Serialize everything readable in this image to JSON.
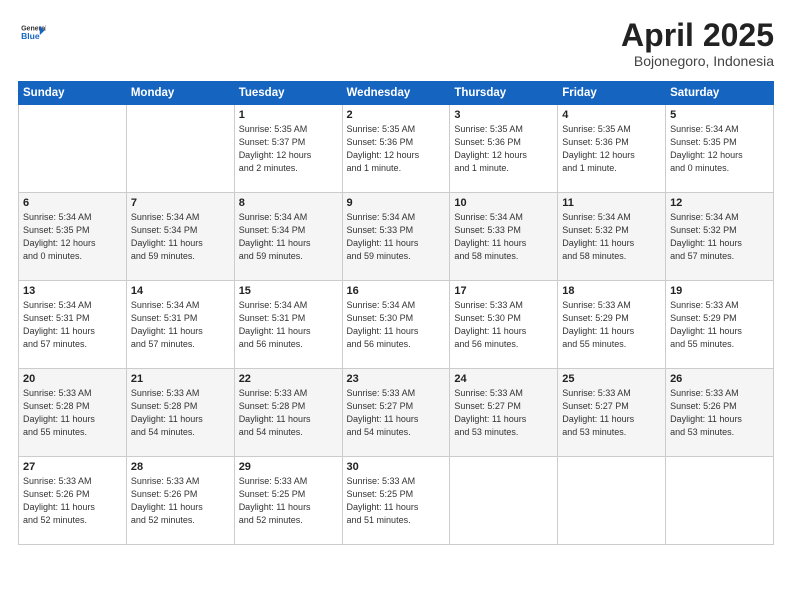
{
  "header": {
    "logo_line1": "General",
    "logo_line2": "Blue",
    "month": "April 2025",
    "location": "Bojonegoro, Indonesia"
  },
  "days_of_week": [
    "Sunday",
    "Monday",
    "Tuesday",
    "Wednesday",
    "Thursday",
    "Friday",
    "Saturday"
  ],
  "weeks": [
    [
      {
        "day": "",
        "detail": ""
      },
      {
        "day": "",
        "detail": ""
      },
      {
        "day": "1",
        "detail": "Sunrise: 5:35 AM\nSunset: 5:37 PM\nDaylight: 12 hours\nand 2 minutes."
      },
      {
        "day": "2",
        "detail": "Sunrise: 5:35 AM\nSunset: 5:36 PM\nDaylight: 12 hours\nand 1 minute."
      },
      {
        "day": "3",
        "detail": "Sunrise: 5:35 AM\nSunset: 5:36 PM\nDaylight: 12 hours\nand 1 minute."
      },
      {
        "day": "4",
        "detail": "Sunrise: 5:35 AM\nSunset: 5:36 PM\nDaylight: 12 hours\nand 1 minute."
      },
      {
        "day": "5",
        "detail": "Sunrise: 5:34 AM\nSunset: 5:35 PM\nDaylight: 12 hours\nand 0 minutes."
      }
    ],
    [
      {
        "day": "6",
        "detail": "Sunrise: 5:34 AM\nSunset: 5:35 PM\nDaylight: 12 hours\nand 0 minutes."
      },
      {
        "day": "7",
        "detail": "Sunrise: 5:34 AM\nSunset: 5:34 PM\nDaylight: 11 hours\nand 59 minutes."
      },
      {
        "day": "8",
        "detail": "Sunrise: 5:34 AM\nSunset: 5:34 PM\nDaylight: 11 hours\nand 59 minutes."
      },
      {
        "day": "9",
        "detail": "Sunrise: 5:34 AM\nSunset: 5:33 PM\nDaylight: 11 hours\nand 59 minutes."
      },
      {
        "day": "10",
        "detail": "Sunrise: 5:34 AM\nSunset: 5:33 PM\nDaylight: 11 hours\nand 58 minutes."
      },
      {
        "day": "11",
        "detail": "Sunrise: 5:34 AM\nSunset: 5:32 PM\nDaylight: 11 hours\nand 58 minutes."
      },
      {
        "day": "12",
        "detail": "Sunrise: 5:34 AM\nSunset: 5:32 PM\nDaylight: 11 hours\nand 57 minutes."
      }
    ],
    [
      {
        "day": "13",
        "detail": "Sunrise: 5:34 AM\nSunset: 5:31 PM\nDaylight: 11 hours\nand 57 minutes."
      },
      {
        "day": "14",
        "detail": "Sunrise: 5:34 AM\nSunset: 5:31 PM\nDaylight: 11 hours\nand 57 minutes."
      },
      {
        "day": "15",
        "detail": "Sunrise: 5:34 AM\nSunset: 5:31 PM\nDaylight: 11 hours\nand 56 minutes."
      },
      {
        "day": "16",
        "detail": "Sunrise: 5:34 AM\nSunset: 5:30 PM\nDaylight: 11 hours\nand 56 minutes."
      },
      {
        "day": "17",
        "detail": "Sunrise: 5:33 AM\nSunset: 5:30 PM\nDaylight: 11 hours\nand 56 minutes."
      },
      {
        "day": "18",
        "detail": "Sunrise: 5:33 AM\nSunset: 5:29 PM\nDaylight: 11 hours\nand 55 minutes."
      },
      {
        "day": "19",
        "detail": "Sunrise: 5:33 AM\nSunset: 5:29 PM\nDaylight: 11 hours\nand 55 minutes."
      }
    ],
    [
      {
        "day": "20",
        "detail": "Sunrise: 5:33 AM\nSunset: 5:28 PM\nDaylight: 11 hours\nand 55 minutes."
      },
      {
        "day": "21",
        "detail": "Sunrise: 5:33 AM\nSunset: 5:28 PM\nDaylight: 11 hours\nand 54 minutes."
      },
      {
        "day": "22",
        "detail": "Sunrise: 5:33 AM\nSunset: 5:28 PM\nDaylight: 11 hours\nand 54 minutes."
      },
      {
        "day": "23",
        "detail": "Sunrise: 5:33 AM\nSunset: 5:27 PM\nDaylight: 11 hours\nand 54 minutes."
      },
      {
        "day": "24",
        "detail": "Sunrise: 5:33 AM\nSunset: 5:27 PM\nDaylight: 11 hours\nand 53 minutes."
      },
      {
        "day": "25",
        "detail": "Sunrise: 5:33 AM\nSunset: 5:27 PM\nDaylight: 11 hours\nand 53 minutes."
      },
      {
        "day": "26",
        "detail": "Sunrise: 5:33 AM\nSunset: 5:26 PM\nDaylight: 11 hours\nand 53 minutes."
      }
    ],
    [
      {
        "day": "27",
        "detail": "Sunrise: 5:33 AM\nSunset: 5:26 PM\nDaylight: 11 hours\nand 52 minutes."
      },
      {
        "day": "28",
        "detail": "Sunrise: 5:33 AM\nSunset: 5:26 PM\nDaylight: 11 hours\nand 52 minutes."
      },
      {
        "day": "29",
        "detail": "Sunrise: 5:33 AM\nSunset: 5:25 PM\nDaylight: 11 hours\nand 52 minutes."
      },
      {
        "day": "30",
        "detail": "Sunrise: 5:33 AM\nSunset: 5:25 PM\nDaylight: 11 hours\nand 51 minutes."
      },
      {
        "day": "",
        "detail": ""
      },
      {
        "day": "",
        "detail": ""
      },
      {
        "day": "",
        "detail": ""
      }
    ]
  ]
}
